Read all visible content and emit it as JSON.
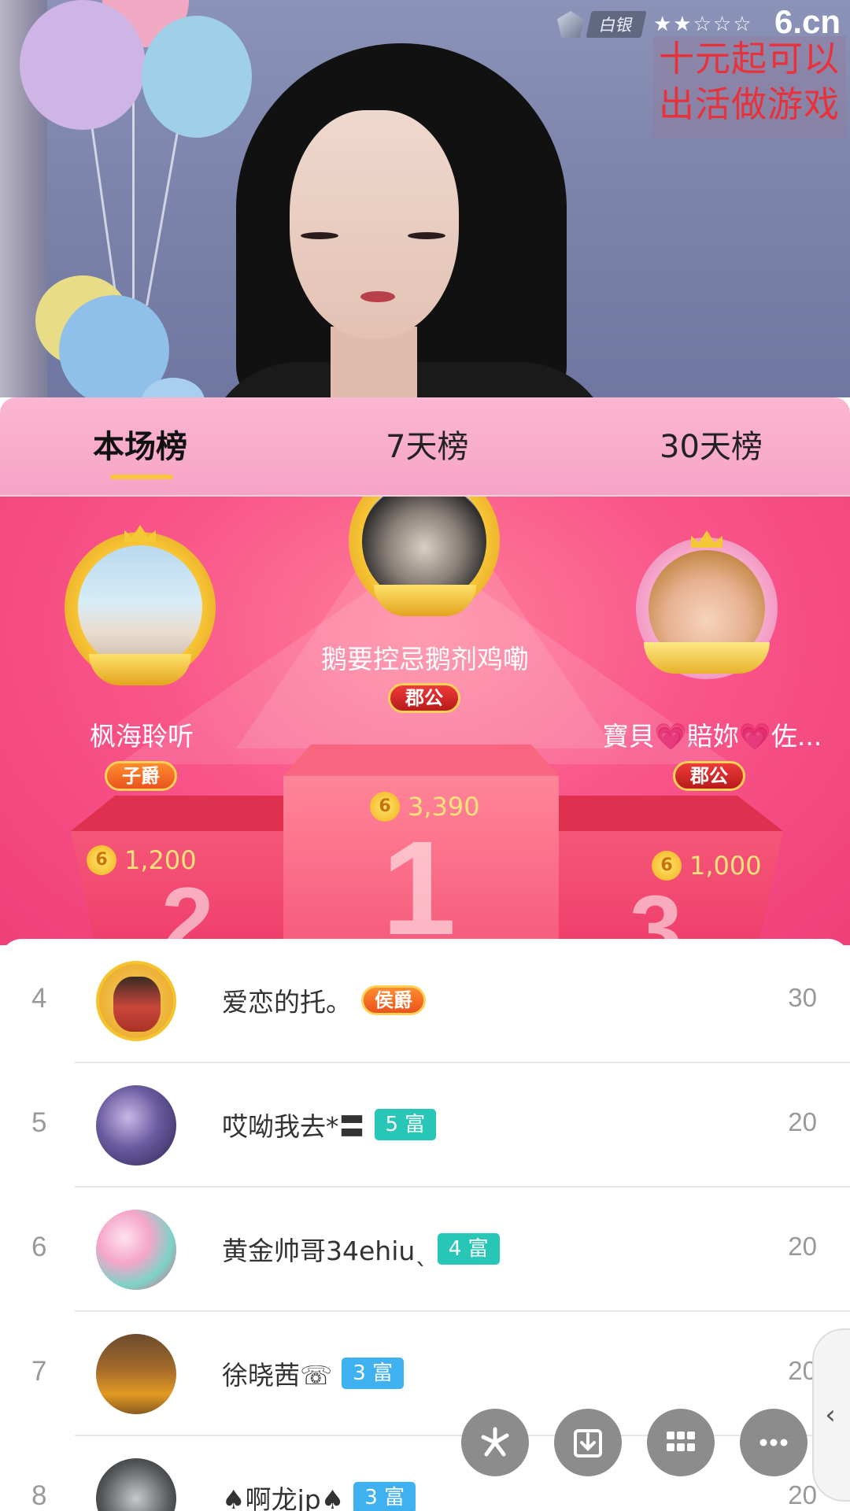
{
  "stream": {
    "anchor_level_label": "白银",
    "stars_text": "★★☆☆☆",
    "site_logo": "6.cn",
    "overlay_line1": "十元起可以",
    "overlay_line2": "出活做游戏"
  },
  "tabs": [
    {
      "label": "本场榜",
      "active": true
    },
    {
      "label": "7天榜",
      "active": false
    },
    {
      "label": "30天榜",
      "active": false
    }
  ],
  "podium": {
    "first": {
      "name": "鹅要控忌鹅剂鸡嘞",
      "title": "郡公",
      "score": "3,390"
    },
    "second": {
      "name": "枫海聆听",
      "title": "子爵",
      "score": "1,200"
    },
    "third": {
      "name": "寶貝💗賠妳💗佐...",
      "title": "郡公",
      "score": "1,000"
    },
    "coin_symbol": "6"
  },
  "rows": [
    {
      "rank": "4",
      "name": "爱恋的托。",
      "badge": "侯爵",
      "badge_type": "noble",
      "score": "30"
    },
    {
      "rank": "5",
      "name": "哎呦我去*〓",
      "badge": "5 富",
      "badge_type": "teal",
      "score": "20"
    },
    {
      "rank": "6",
      "name": "黄金帅哥34ehiuˎ",
      "badge": "4 富",
      "badge_type": "teal",
      "score": "20"
    },
    {
      "rank": "7",
      "name": "徐晓茜☏",
      "badge": "3 富",
      "badge_type": "blue",
      "score": "20"
    },
    {
      "rank": "8",
      "name": "♠啊龙jp♠",
      "badge": "3 富",
      "badge_type": "blue",
      "score": "20"
    }
  ],
  "colors": {
    "tab_bg": "#f9aecb",
    "podium_bg": "#f4507f",
    "tab_indicator": "#f8c63e",
    "score_gold": "#ffe27a",
    "rich_teal": "#27c6b6",
    "rich_blue": "#3fb1f0"
  },
  "controls": {
    "icons": [
      "sparkle-icon",
      "download-icon",
      "grid-icon",
      "more-icon",
      "chevron-left-icon"
    ],
    "side_tab_label": "‹"
  }
}
